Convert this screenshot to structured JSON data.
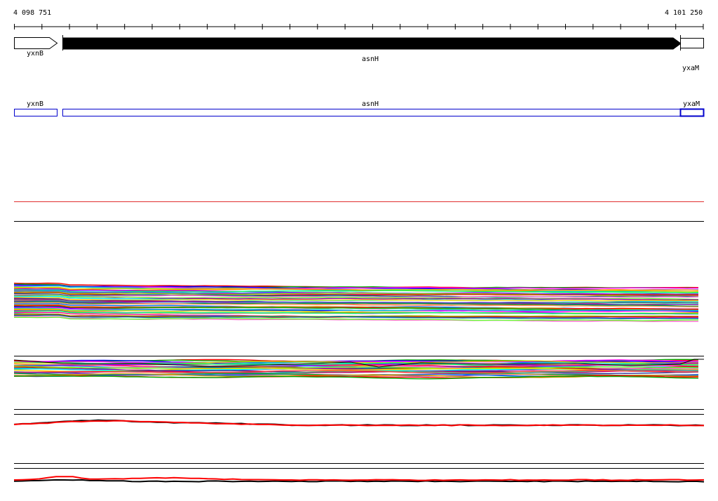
{
  "coordinates": {
    "start": "4 098 751",
    "end": "4 101 250"
  },
  "genes": [
    {
      "name": "yxnB",
      "strand": "+",
      "style": "open"
    },
    {
      "name": "asnH",
      "strand": "+",
      "style": "filled"
    },
    {
      "name": "yxaM",
      "strand": "+",
      "style": "open"
    }
  ],
  "annotation_track": {
    "labels": [
      "yxnB",
      "asnH",
      "yxaM"
    ],
    "color": "#0000cc"
  },
  "colors": {
    "threshold_line": "#e03030",
    "profile_red": "#ff0000",
    "profile_black": "#000000",
    "frame": "#000000"
  }
}
